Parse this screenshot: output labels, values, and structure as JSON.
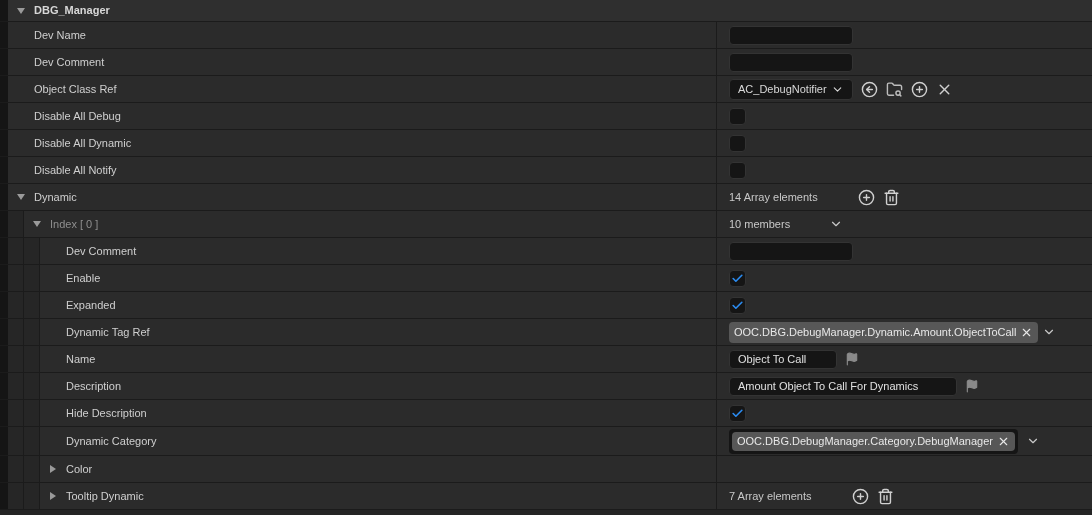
{
  "category": {
    "label": "DBG_Manager",
    "expanded": true,
    "children": [
      {
        "label": "Dev Name",
        "value": {
          "kind": "text_field"
        }
      },
      {
        "label": "Dev Comment",
        "value": {
          "kind": "text_field"
        }
      },
      {
        "label": "Object Class Ref",
        "value": {
          "kind": "class_picker",
          "text": "AC_DebugNotifier"
        }
      },
      {
        "label": "Disable All Debug",
        "value": {
          "kind": "checkbox",
          "checked": false
        }
      },
      {
        "label": "Disable All Dynamic",
        "value": {
          "kind": "checkbox",
          "checked": false
        }
      },
      {
        "label": "Disable All Notify",
        "value": {
          "kind": "checkbox",
          "checked": false
        }
      },
      {
        "label": "Dynamic",
        "expanded": true,
        "value": {
          "kind": "array",
          "text": "14 Array elements"
        },
        "children": [
          {
            "label": "Index [ 0 ]",
            "expanded": true,
            "value": {
              "kind": "members",
              "text": "10 members"
            },
            "children": [
              {
                "label": "Dev Comment",
                "value": {
                  "kind": "text_field"
                }
              },
              {
                "label": "Enable",
                "value": {
                  "kind": "checkbox",
                  "checked": true
                }
              },
              {
                "label": "Expanded",
                "value": {
                  "kind": "checkbox",
                  "checked": true
                }
              },
              {
                "label": "Dynamic Tag Ref",
                "value": {
                  "kind": "tag",
                  "text": "OOC.DBG.DebugManager.Dynamic.Amount.ObjectToCall"
                }
              },
              {
                "label": "Name",
                "value": {
                  "kind": "localized_text",
                  "text": "Object To Call"
                }
              },
              {
                "label": "Description",
                "value": {
                  "kind": "localized_text",
                  "text": "Amount Object To Call For Dynamics"
                }
              },
              {
                "label": "Hide Description",
                "value": {
                  "kind": "checkbox",
                  "checked": true
                }
              },
              {
                "label": "Dynamic Category",
                "value": {
                  "kind": "tag_container",
                  "text": "OOC.DBG.DebugManager.Category.DebugManager"
                }
              },
              {
                "label": "Color",
                "expanded": false
              },
              {
                "label": "Tooltip Dynamic",
                "expanded": false,
                "value": {
                  "kind": "array",
                  "text": "7 Array elements"
                }
              }
            ]
          }
        ]
      }
    ]
  }
}
